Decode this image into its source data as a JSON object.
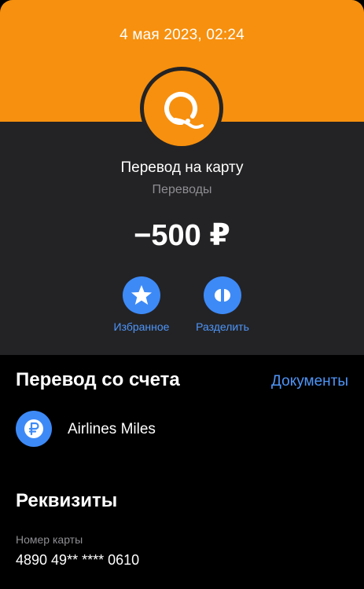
{
  "colors": {
    "brand_orange": "#F7900E",
    "accent_blue": "#3D8AF7",
    "card_background": "#232325",
    "page_background": "#000000",
    "muted_text": "#8E8E93"
  },
  "header": {
    "datetime": "4 мая 2023, 02:24",
    "logo_icon": "qiwi-logo-icon"
  },
  "transaction": {
    "title": "Перевод на карту",
    "category": "Переводы",
    "amount": "−500 ₽"
  },
  "actions": [
    {
      "icon": "star-icon",
      "label": "Избранное"
    },
    {
      "icon": "split-icon",
      "label": "Разделить"
    }
  ],
  "source_section": {
    "title": "Перевод со счета",
    "documents_link": "Документы",
    "account": {
      "icon": "ruble-icon",
      "name": "Airlines Miles"
    }
  },
  "details_section": {
    "title": "Реквизиты",
    "card_number_label": "Номер карты",
    "card_number_value": "4890 49** **** 0610"
  }
}
